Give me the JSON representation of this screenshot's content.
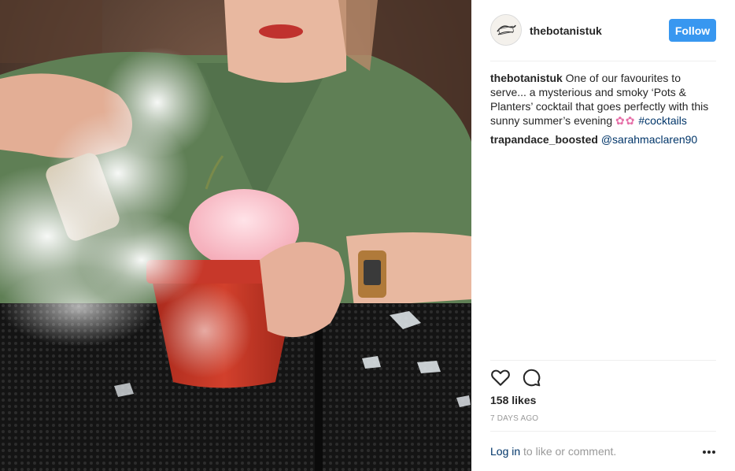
{
  "post": {
    "username": "thebotanistuk",
    "follow_label": "Follow",
    "caption": {
      "username": "thebotanistuk",
      "text": "One of our favourites to serve... a mysterious and smoky ‘Pots & Planters’ cocktail that goes perfectly with this sunny summer’s evening",
      "emoji": "✿✿",
      "hashtag": "#cocktails"
    },
    "comments": [
      {
        "username": "trapandace_boosted",
        "mention": "@sarahmaclaren90"
      }
    ],
    "likes": "158 likes",
    "timestamp": "7 DAYS AGO",
    "footer": {
      "login_label": "Log in",
      "rest": " to like or comment."
    }
  },
  "icons": {
    "like": "heart-icon",
    "comment": "comment-icon",
    "more": "more-options-icon",
    "avatar": "botanist-logo"
  },
  "colors": {
    "follow_button": "#3897f0",
    "link": "#003569",
    "muted": "#999999",
    "text": "#262626"
  }
}
